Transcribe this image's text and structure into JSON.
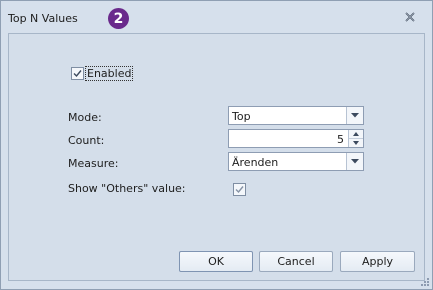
{
  "window": {
    "title": "Top N Values",
    "badge": "2"
  },
  "form": {
    "enabled_label": "Enabled",
    "enabled_checked": true,
    "mode_label": "Mode:",
    "mode_value": "Top",
    "count_label": "Count:",
    "count_value": "5",
    "measure_label": "Measure:",
    "measure_value": "Ärenden",
    "others_label": "Show \"Others\" value:",
    "others_checked": true
  },
  "buttons": {
    "ok": "OK",
    "cancel": "Cancel",
    "apply": "Apply"
  },
  "icons": {
    "close": "close-icon",
    "dropdown": "chevron-down-icon",
    "spin_up": "arrow-up-icon",
    "spin_down": "arrow-down-icon",
    "check": "check-icon"
  },
  "colors": {
    "badge": "#6a2a8c",
    "background": "#d6e0ec"
  }
}
